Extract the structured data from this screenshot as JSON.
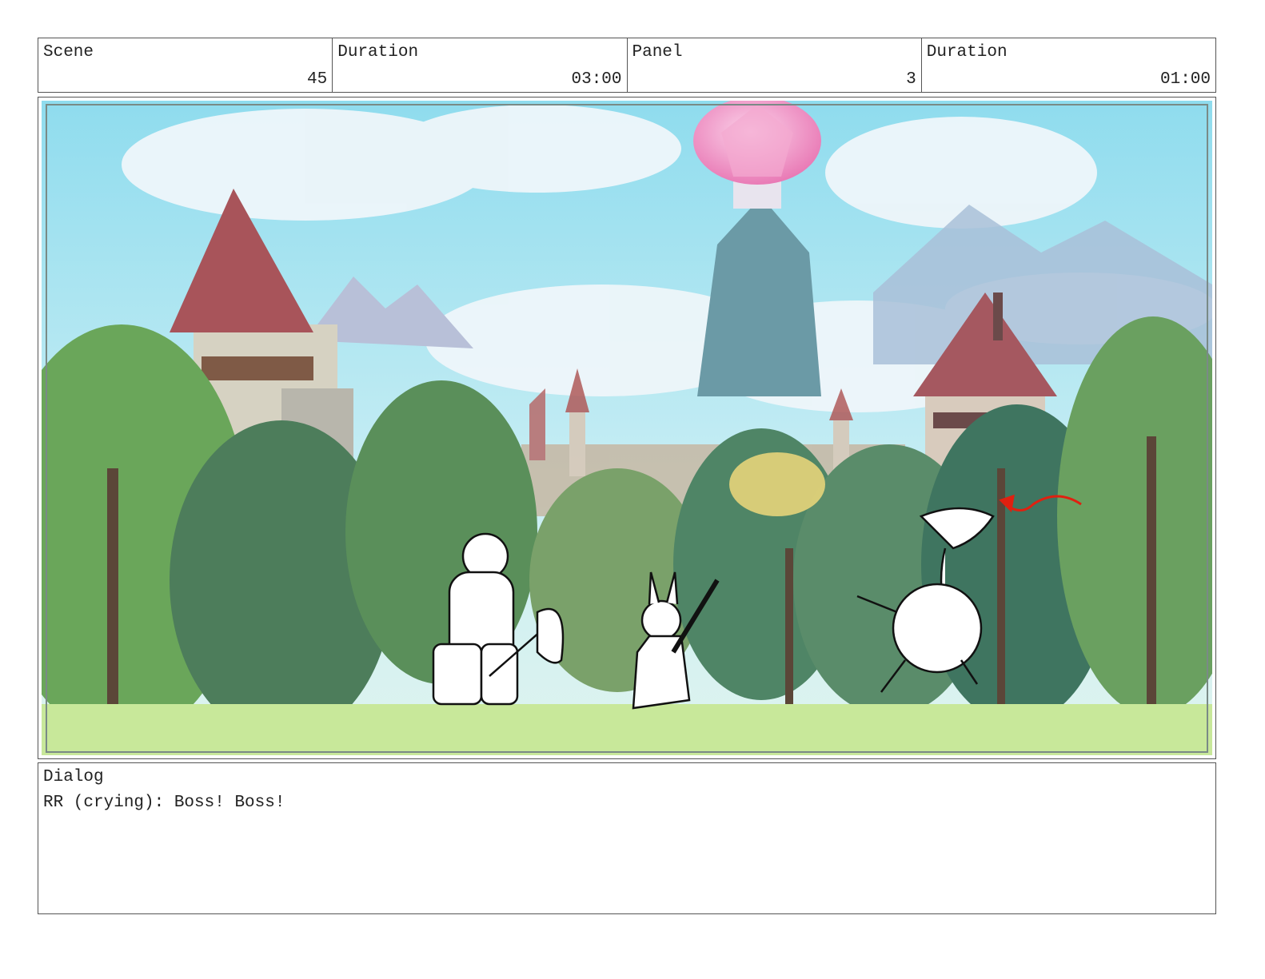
{
  "header": {
    "scene_label": "Scene",
    "scene_value": "45",
    "scene_duration_label": "Duration",
    "scene_duration_value": "03:00",
    "panel_label": "Panel",
    "panel_value": "3",
    "panel_duration_label": "Duration",
    "panel_duration_value": "01:00"
  },
  "artwork": {
    "sky_color": "#7fd6ea",
    "grass_color": "#c8e89a",
    "crystal_color": "#f08ac0",
    "arrow_color": "#e02010"
  },
  "dialog": {
    "label": "Dialog",
    "text": "RR (crying): Boss! Boss!"
  }
}
